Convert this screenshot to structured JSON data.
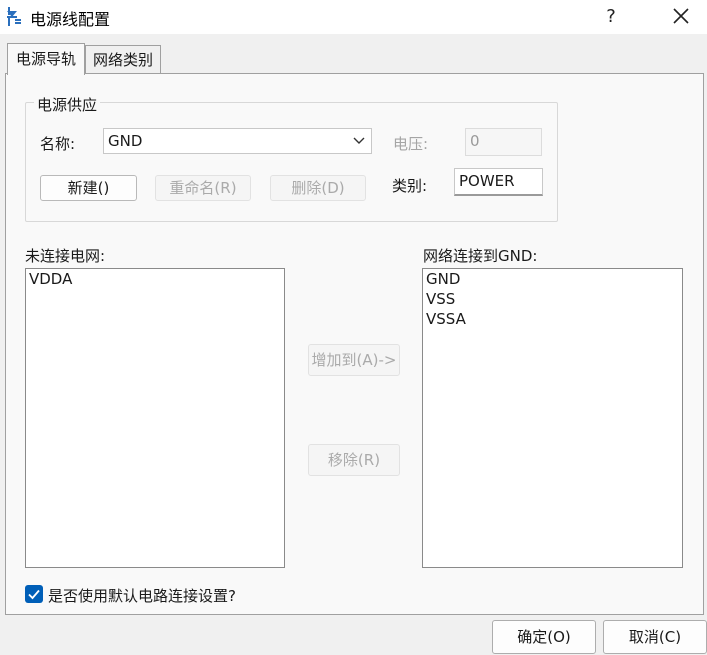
{
  "window": {
    "title": "电源线配置",
    "help": "?"
  },
  "tabs": [
    {
      "label": "电源导轨",
      "active": true
    },
    {
      "label": "网络类别",
      "active": false
    }
  ],
  "power_supply": {
    "group_title": "电源供应",
    "name_label": "名称:",
    "name_value": "GND",
    "voltage_label": "电压:",
    "voltage_value": "0",
    "category_label": "类别:",
    "category_value": "POWER",
    "new_button": "新建()",
    "rename_button": "重命名(R)",
    "delete_button": "删除(D)"
  },
  "unconnected": {
    "label": "未连接电网:",
    "items": [
      "VDDA"
    ]
  },
  "connected": {
    "label": "网络连接到GND:",
    "items": [
      "GND",
      "VSS",
      "VSSA"
    ]
  },
  "actions": {
    "add": "增加到(A)->",
    "remove": "移除(R)"
  },
  "default_setting": {
    "label": "是否使用默认电路连接设置?",
    "checked": true
  },
  "footer": {
    "ok": "确定(O)",
    "cancel": "取消(C)"
  },
  "colors": {
    "accent": "#005fb8",
    "disabled_text": "#aaaaaa"
  },
  "icons": {
    "app": "diode-icon",
    "close": "close-icon",
    "dropdown": "chevron-down-icon",
    "check": "check-icon"
  }
}
